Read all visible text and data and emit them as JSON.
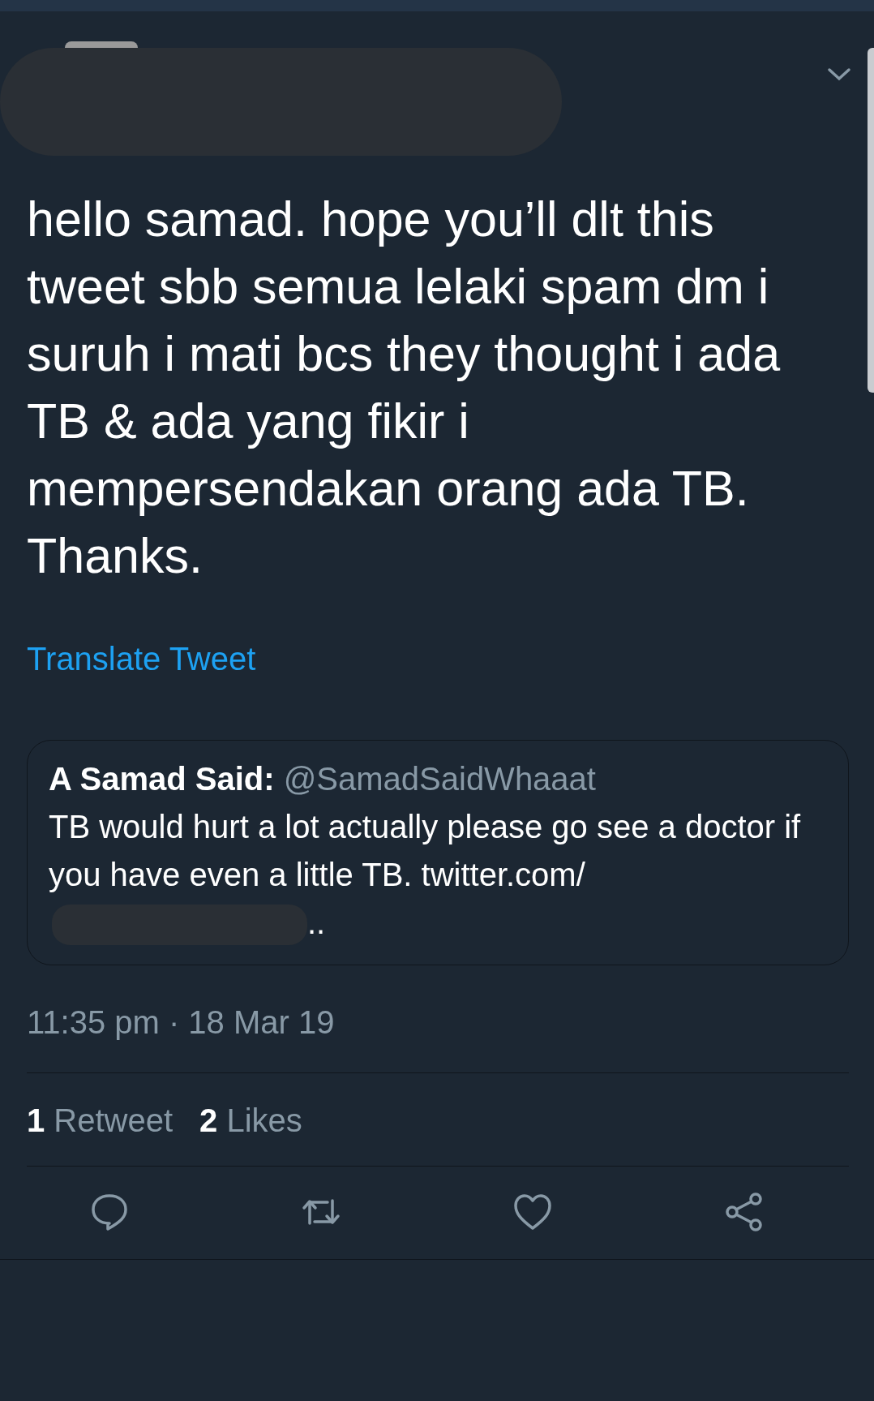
{
  "tweet": {
    "text": "hello samad. hope you’ll dlt this tweet sbb semua lelaki spam dm i suruh i mati bcs they thought i ada TB & ada yang fikir i mempersendakan orang ada TB. Thanks.",
    "translate_link": "Translate Tweet",
    "quoted": {
      "name": "A Samad Said:",
      "handle": "@SamadSaidWhaaat",
      "text": "TB would hurt a lot actually please go see a doctor if you have even a little TB. twitter.com/",
      "tail": ".."
    },
    "timestamp": "11:35 pm · 18 Mar 19",
    "stats": [
      {
        "count": "1",
        "label": "Retweet"
      },
      {
        "count": "2",
        "label": "Likes"
      }
    ],
    "actions": [
      {
        "kind": "reply"
      },
      {
        "kind": "retweet"
      },
      {
        "kind": "like"
      },
      {
        "kind": "share"
      }
    ]
  }
}
